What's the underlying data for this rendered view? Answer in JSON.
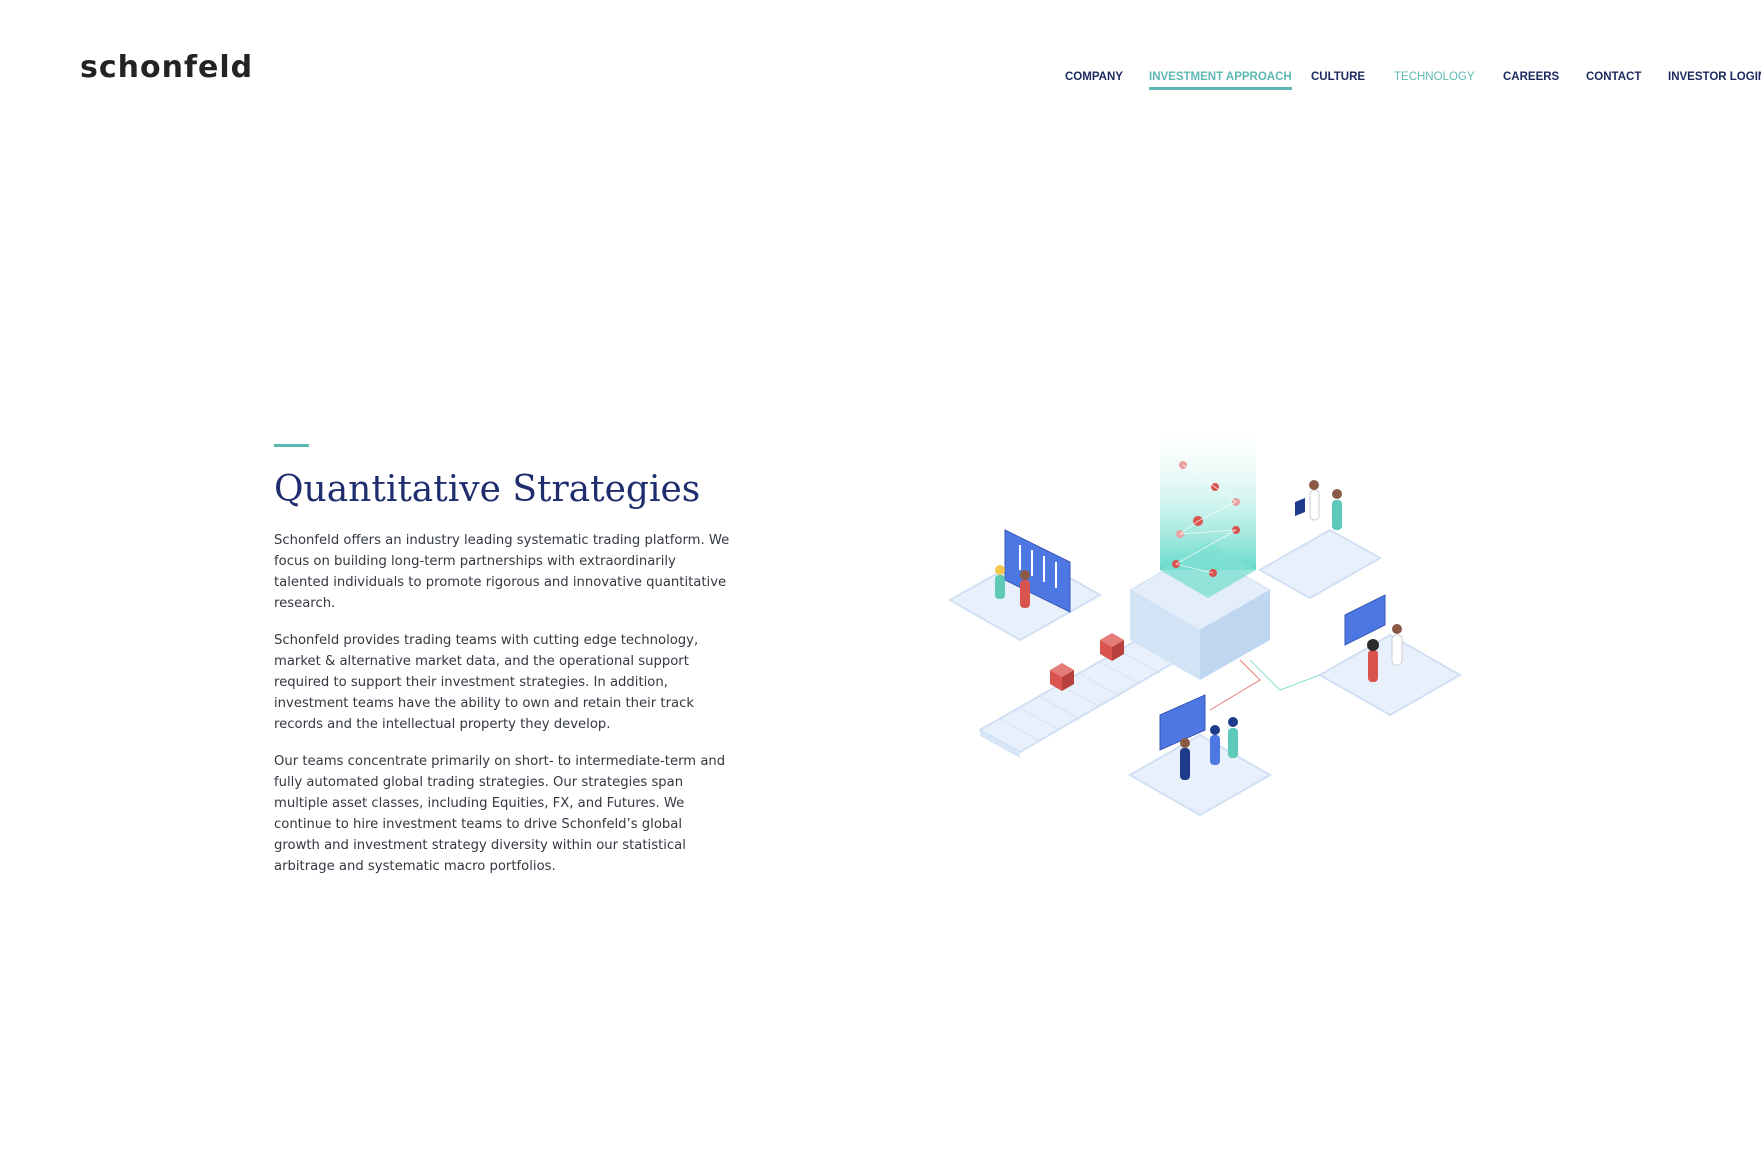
{
  "brand": {
    "logo_text": "schonfeld"
  },
  "nav": {
    "items": [
      {
        "label": "COMPANY"
      },
      {
        "label": "INVESTMENT APPROACH",
        "state": "active"
      },
      {
        "label": "CULTURE"
      },
      {
        "label": "TECHNOLOGY",
        "state": "highlight"
      },
      {
        "label": "CAREERS"
      },
      {
        "label": "CONTACT"
      },
      {
        "label": "INVESTOR LOGIN"
      }
    ]
  },
  "content": {
    "title": "Quantitative Strategies",
    "paragraphs": [
      "Schonfeld offers an industry leading systematic trading platform. We focus on building long-term partnerships with extraordinarily talented individuals to promote rigorous and innovative quantitative research.",
      "Schonfeld provides trading teams with cutting edge technology, market & alternative market data, and the operational support required to support their investment strategies. In addition, investment teams have the ability to own and retain their track records and the intellectual property they develop.",
      "Our teams concentrate primarily on short- to intermediate-term and fully automated global trading strategies. Our strategies span multiple asset classes, including Equities, FX, and Futures. We continue to hire investment teams to drive Schonfeld’s global growth and investment strategy diversity within our statistical arbitrage and systematic macro portfolios."
    ]
  },
  "illustration": {
    "icon": "isometric-trading-platform-illustration"
  },
  "colors": {
    "navy": "#1b2a5e",
    "heading": "#1f2d6e",
    "teal": "#5cb8b2",
    "body_text": "#333841",
    "illustration_blue": "#4d78e3",
    "illustration_red": "#d9534f",
    "platform": "#e8f1fb"
  }
}
